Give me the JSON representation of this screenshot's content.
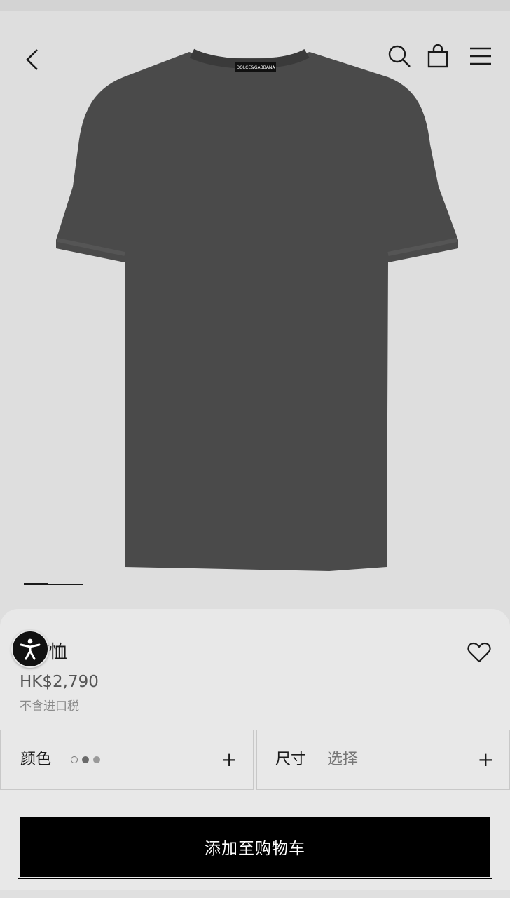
{
  "header": {
    "back_icon": "chevron-left-icon",
    "search_icon": "search-icon",
    "bag_icon": "shopping-bag-icon",
    "menu_icon": "hamburger-menu-icon"
  },
  "product_image": {
    "brand_label": "DOLCE&GABBANA",
    "gallery": {
      "total": 2,
      "active": 1
    }
  },
  "product": {
    "name": "质T恤",
    "price": "HK$2,790",
    "tax_note": "不含进口税",
    "favorite_icon": "heart-outline-icon",
    "accessibility_icon": "accessibility-icon"
  },
  "options": {
    "color_label": "颜色",
    "colors": [
      "#ffffff",
      "#6a6a6a",
      "#9a9a9a"
    ],
    "size_label": "尺寸",
    "size_value": "选择",
    "expand_symbol": "+"
  },
  "cta": {
    "add_to_cart_label": "添加至购物车"
  },
  "colors": {
    "shirt": "#4a4a4a",
    "background": "#dedede",
    "button": "#000000"
  }
}
